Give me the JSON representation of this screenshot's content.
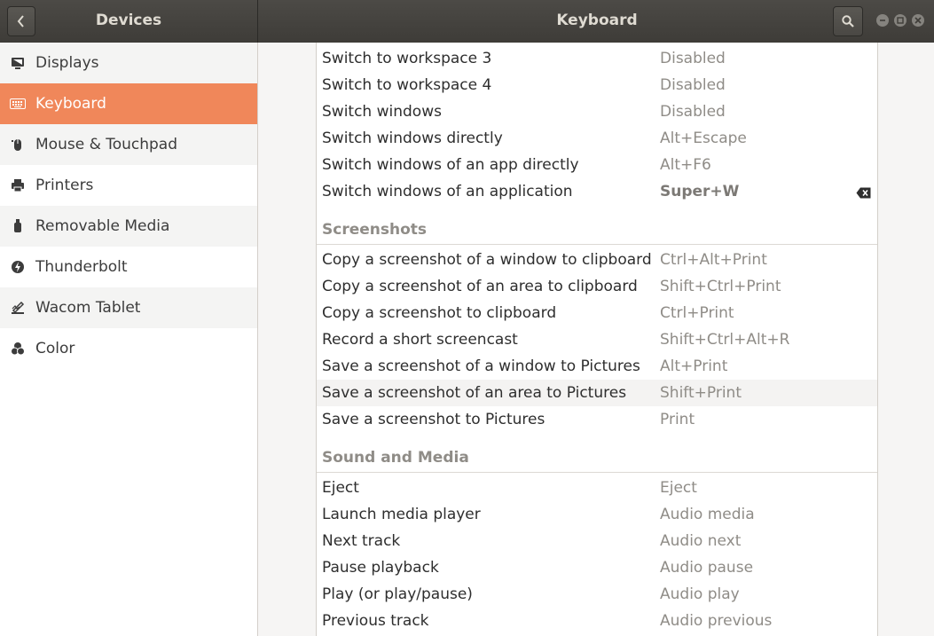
{
  "header": {
    "left_title": "Devices",
    "main_title": "Keyboard"
  },
  "sidebar": {
    "items": [
      {
        "label": "Displays",
        "icon": "display-icon"
      },
      {
        "label": "Keyboard",
        "icon": "keyboard-icon",
        "active": true
      },
      {
        "label": "Mouse & Touchpad",
        "icon": "mouse-icon"
      },
      {
        "label": "Printers",
        "icon": "printer-icon"
      },
      {
        "label": "Removable Media",
        "icon": "usb-drive-icon"
      },
      {
        "label": "Thunderbolt",
        "icon": "thunderbolt-icon"
      },
      {
        "label": "Wacom Tablet",
        "icon": "tablet-icon"
      },
      {
        "label": "Color",
        "icon": "color-icon"
      }
    ]
  },
  "shortcuts": {
    "navigation_rows": [
      {
        "name": "Switch to workspace 3",
        "accel": "Disabled"
      },
      {
        "name": "Switch to workspace 4",
        "accel": "Disabled"
      },
      {
        "name": "Switch windows",
        "accel": "Disabled"
      },
      {
        "name": "Switch windows directly",
        "accel": "Alt+Escape"
      },
      {
        "name": "Switch windows of an app directly",
        "accel": "Alt+F6"
      },
      {
        "name": "Switch windows of an application",
        "accel": "Super+W"
      }
    ],
    "screenshots": {
      "title": "Screenshots",
      "rows": [
        {
          "name": "Copy a screenshot of a window to clipboard",
          "accel": "Ctrl+Alt+Print"
        },
        {
          "name": "Copy a screenshot of an area to clipboard",
          "accel": "Shift+Ctrl+Print"
        },
        {
          "name": "Copy a screenshot to clipboard",
          "accel": "Ctrl+Print"
        },
        {
          "name": "Record a short screencast",
          "accel": "Shift+Ctrl+Alt+R"
        },
        {
          "name": "Save a screenshot of a window to Pictures",
          "accel": "Alt+Print"
        },
        {
          "name": "Save a screenshot of an area to Pictures",
          "accel": "Shift+Print"
        },
        {
          "name": "Save a screenshot to Pictures",
          "accel": "Print"
        }
      ]
    },
    "sound_media": {
      "title": "Sound and Media",
      "rows": [
        {
          "name": "Eject",
          "accel": "Eject"
        },
        {
          "name": "Launch media player",
          "accel": "Audio media"
        },
        {
          "name": "Next track",
          "accel": "Audio next"
        },
        {
          "name": "Pause playback",
          "accel": "Audio pause"
        },
        {
          "name": "Play (or play/pause)",
          "accel": "Audio play"
        },
        {
          "name": "Previous track",
          "accel": "Audio previous"
        }
      ]
    }
  },
  "colors": {
    "accent": "#f0875a",
    "headerbar": "#45433f"
  }
}
